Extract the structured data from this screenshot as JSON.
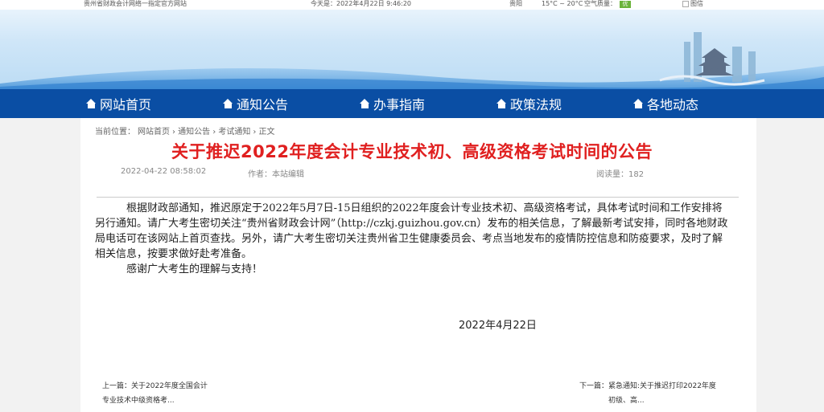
{
  "topbar": {
    "site_name": "贵州省财政会计网络一指定官方网站",
    "date": "今天是：2022年4月22日 9:46:20",
    "city": "贵阳",
    "weather": "15°C ~ 20°C",
    "air_quality_label": "空气质量：",
    "air_quality_value": "优",
    "image_alt": "图信"
  },
  "nav": {
    "items": [
      "网站首页",
      "通知公告",
      "办事指南",
      "政策法规",
      "各地动态"
    ]
  },
  "breadcrumb": [
    "当前位置：",
    "网站首页",
    "› 通知公告",
    "› 考试通知",
    "› 正文"
  ],
  "article": {
    "title": "关于推迟2022年度会计专业技术初、高级资格考试时间的公告",
    "date": "2022-04-22 08:58:02",
    "author": "作者：本站编辑",
    "reads": "阅读量：182",
    "paragraph1": "根据财政部通知，推迟原定于2022年5月7日-15日组织的2022年度会计专业技术初、高级资格考试，具体考试时间和工作安排将另行通知。请广大考生密切关注“贵州省财政会计网”（http://czkj.guizhou.gov.cn）发布的相关信息，了解最新考试安排，同时各地财政局电话可在该网站上首页查找。另外，请广大考生密切关注贵州省卫生健康委员会、考点当地发布的疫情防控信息和防疫要求，及时了解相关信息，按要求做好赴考准备。",
    "paragraph2": "感谢广大考生的理解与支持！",
    "signature_date": "2022年4月22日"
  },
  "prev": {
    "line1": "上一篇：关于2022年度全国会计",
    "line2": "专业技术中级资格考..."
  },
  "next": {
    "line1": "下一篇：紧急通知:关于推迟打印2022年度",
    "line2": "初级、高..."
  }
}
